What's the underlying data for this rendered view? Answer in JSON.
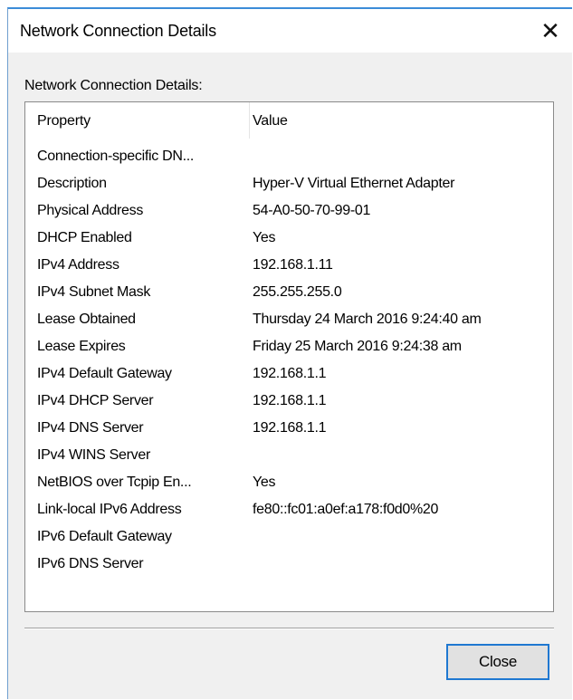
{
  "window": {
    "title": "Network Connection Details",
    "close_glyph": "✕"
  },
  "group_label": "Network Connection Details:",
  "table": {
    "columns": [
      "Property",
      "Value"
    ],
    "rows": [
      {
        "property": "Connection-specific DN...",
        "value": ""
      },
      {
        "property": "Description",
        "value": "Hyper-V Virtual Ethernet Adapter"
      },
      {
        "property": "Physical Address",
        "value": "54-A0-50-70-99-01"
      },
      {
        "property": "DHCP Enabled",
        "value": "Yes"
      },
      {
        "property": "IPv4 Address",
        "value": "192.168.1.11"
      },
      {
        "property": "IPv4 Subnet Mask",
        "value": "255.255.255.0"
      },
      {
        "property": "Lease Obtained",
        "value": "Thursday 24 March 2016 9:24:40 am"
      },
      {
        "property": "Lease Expires",
        "value": "Friday 25 March 2016 9:24:38 am"
      },
      {
        "property": "IPv4 Default Gateway",
        "value": "192.168.1.1"
      },
      {
        "property": "IPv4 DHCP Server",
        "value": "192.168.1.1"
      },
      {
        "property": "IPv4 DNS Server",
        "value": "192.168.1.1"
      },
      {
        "property": "IPv4 WINS Server",
        "value": ""
      },
      {
        "property": "NetBIOS over Tcpip En...",
        "value": "Yes"
      },
      {
        "property": "Link-local IPv6 Address",
        "value": "fe80::fc01:a0ef:a178:f0d0%20"
      },
      {
        "property": "IPv6 Default Gateway",
        "value": ""
      },
      {
        "property": "IPv6 DNS Server",
        "value": ""
      }
    ]
  },
  "buttons": {
    "close_label": "Close"
  },
  "colors": {
    "title_accent": "#3c8cd8",
    "button_focus_border": "#1f78d1"
  }
}
